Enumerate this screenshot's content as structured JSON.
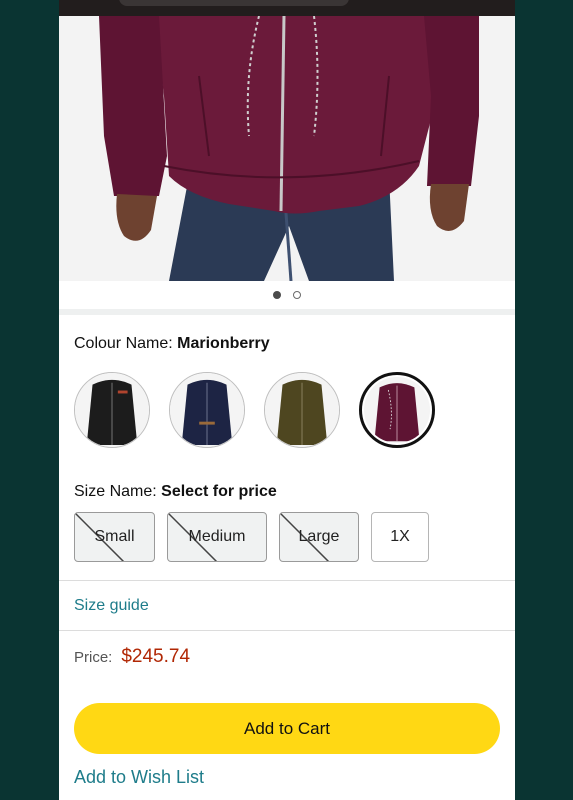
{
  "product": {
    "image_alt": "Marionberry jacket model photo",
    "carousel": {
      "total": 2,
      "active": 1
    }
  },
  "colour": {
    "label": "Colour Name:",
    "value": "Marionberry",
    "swatches": [
      {
        "name": "black",
        "color": "#1c1c1c"
      },
      {
        "name": "navy",
        "color": "#1d2444"
      },
      {
        "name": "olive",
        "color": "#4e4620"
      },
      {
        "name": "marionberry",
        "color": "#5e1433"
      }
    ],
    "selected_index": 3
  },
  "size": {
    "label": "Size Name:",
    "value": "Select for price",
    "options": [
      {
        "label": "Small",
        "available": false
      },
      {
        "label": "Medium",
        "available": false
      },
      {
        "label": "Large",
        "available": false
      },
      {
        "label": "1X",
        "available": true
      }
    ]
  },
  "size_guide": "Size guide",
  "price": {
    "label": "Price:",
    "value": "$245.74"
  },
  "add_to_cart": "Add to Cart",
  "add_to_wish_list": "Add to Wish List",
  "colors": {
    "accent_link": "#1e7c8a",
    "price": "#b12704",
    "cart_button": "#ffd814",
    "background": "#0a3432"
  }
}
